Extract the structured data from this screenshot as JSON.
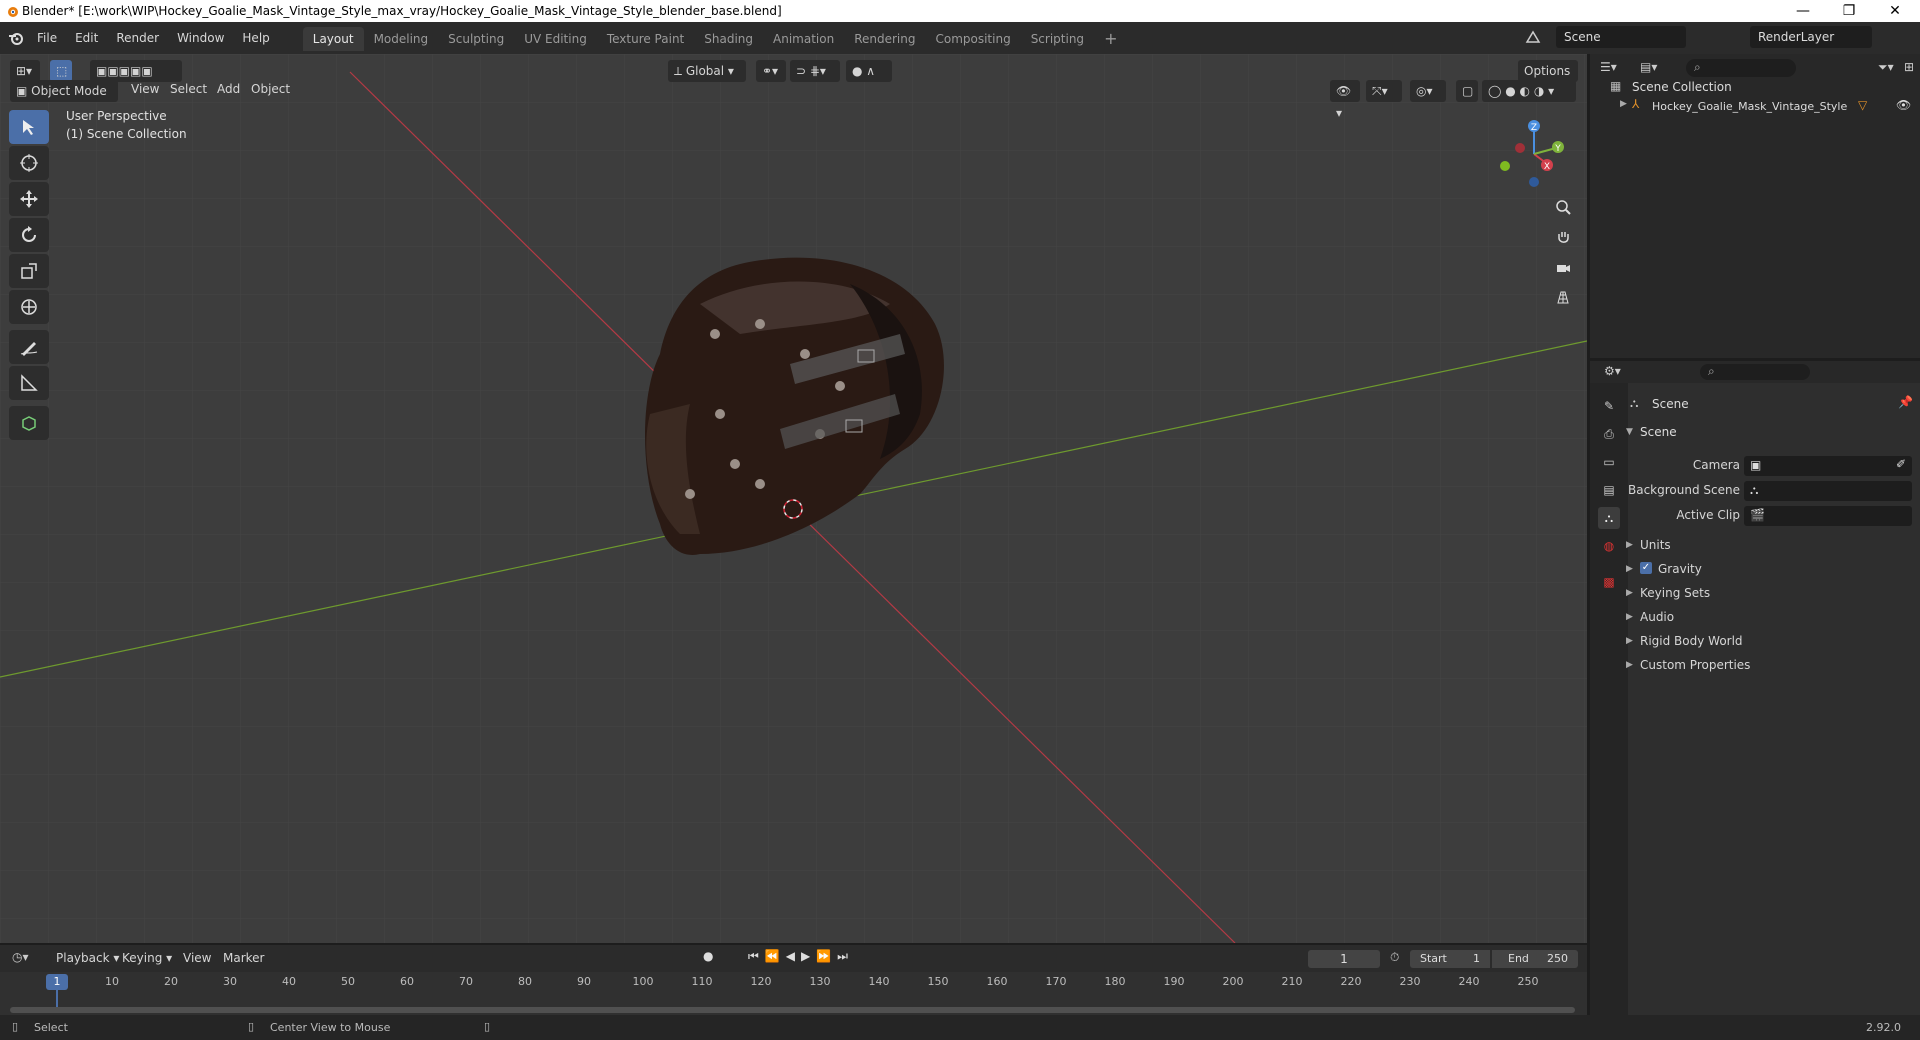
{
  "window": {
    "title": "Blender* [E:\\work\\WIP\\Hockey_Goalie_Mask_Vintage_Style_max_vray/Hockey_Goalie_Mask_Vintage_Style_blender_base.blend]",
    "minimize": "—",
    "restore": "❐",
    "close": "✕"
  },
  "menubar": {
    "menus": [
      "File",
      "Edit",
      "Render",
      "Window",
      "Help"
    ],
    "workspaces": [
      "Layout",
      "Modeling",
      "Sculpting",
      "UV Editing",
      "Texture Paint",
      "Shading",
      "Animation",
      "Rendering",
      "Compositing",
      "Scripting"
    ],
    "add_workspace": "+",
    "scene": "Scene",
    "render_layer": "RenderLayer"
  },
  "viewport": {
    "mode": "Object Mode",
    "menus": [
      "View",
      "Select",
      "Add",
      "Object"
    ],
    "orientation": "Global",
    "options": "Options",
    "overlay_line1": "User Perspective",
    "overlay_line2": "(1) Scene Collection",
    "gizmo": {
      "x": "X",
      "y": "Y",
      "z": "Z"
    }
  },
  "outliner": {
    "root": "Scene Collection",
    "items": [
      {
        "label": "Hockey_Goalie_Mask_Vintage_Style"
      }
    ]
  },
  "properties": {
    "context": "Scene",
    "section": "Scene",
    "fields": [
      {
        "label": "Camera"
      },
      {
        "label": "Background Scene"
      },
      {
        "label": "Active Clip"
      }
    ],
    "panels": [
      "Units",
      "Gravity",
      "Keying Sets",
      "Audio",
      "Rigid Body World",
      "Custom Properties"
    ]
  },
  "timeline": {
    "menus": [
      "Playback",
      "Keying",
      "View",
      "Marker"
    ],
    "current_frame": "1",
    "start_label": "Start",
    "start": "1",
    "end_label": "End",
    "end": "250",
    "ticks": [
      "1",
      "10",
      "20",
      "30",
      "40",
      "50",
      "60",
      "70",
      "80",
      "90",
      "100",
      "110",
      "120",
      "130",
      "140",
      "150",
      "160",
      "170",
      "180",
      "190",
      "200",
      "210",
      "220",
      "230",
      "240",
      "250"
    ]
  },
  "statusbar": {
    "select": "Select",
    "center": "Center View to Mouse",
    "version": "2.92.0"
  },
  "colors": {
    "accent": "#4b6fa8",
    "x_axis": "#d3404c",
    "y_axis": "#7fb33b",
    "z_axis": "#4a8fe0"
  }
}
